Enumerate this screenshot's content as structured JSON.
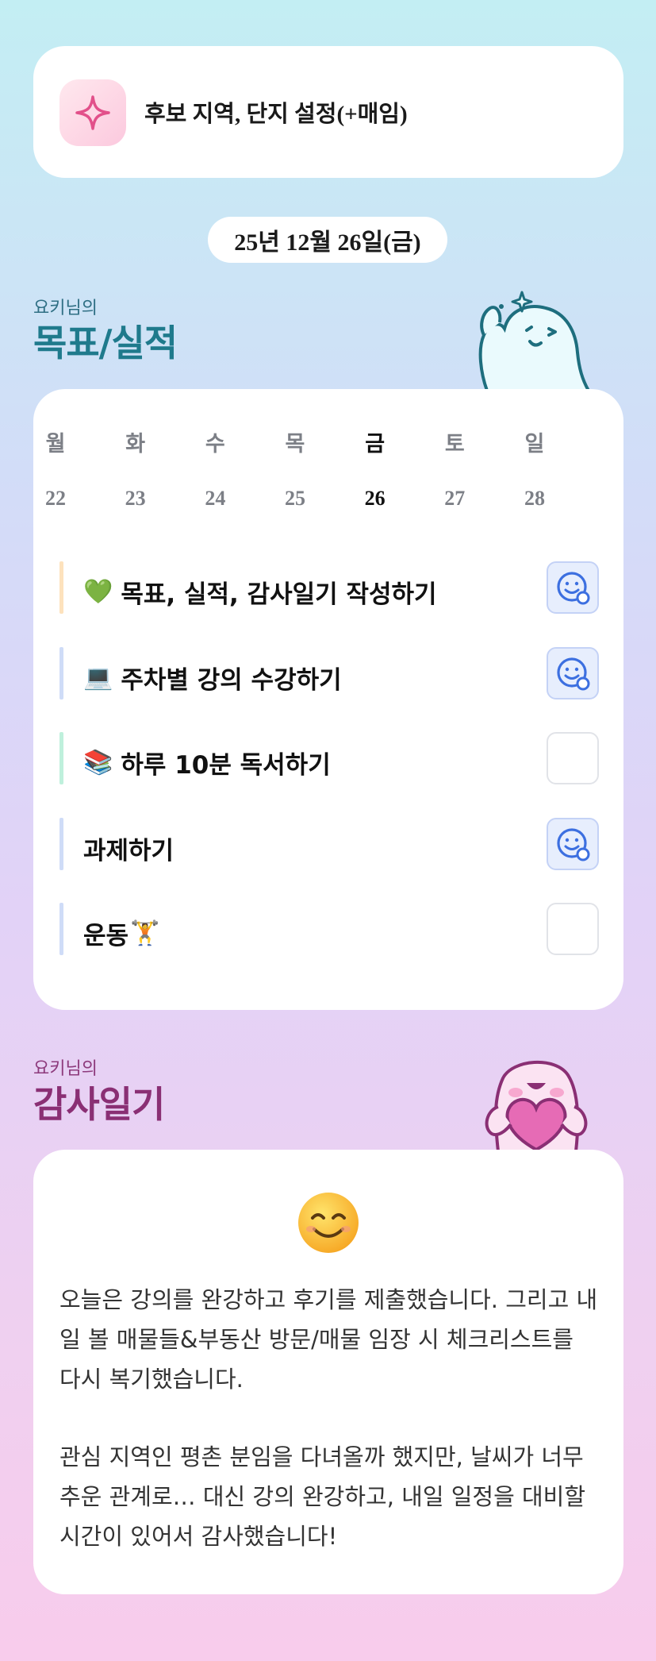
{
  "header": {
    "title": "후보 지역, 단지 설정(+매임)",
    "icon": "sparkle-icon"
  },
  "date": "25년 12월 26일(금)",
  "goals_section": {
    "owner_label": "요키님의",
    "title": "목표/실적"
  },
  "week": {
    "days": [
      "월",
      "화",
      "수",
      "목",
      "금",
      "토",
      "일"
    ],
    "dates": [
      "22",
      "23",
      "24",
      "25",
      "26",
      "27",
      "28"
    ],
    "today_index": 4
  },
  "tasks": [
    {
      "emoji": "💚",
      "label": "목표, 실적, 감사일기 작성하기",
      "done": true,
      "bar_color": "#fde2bd"
    },
    {
      "emoji": "💻",
      "label": "주차별 강의 수강하기",
      "done": true,
      "bar_color": "#cfdcf7"
    },
    {
      "emoji": "📚",
      "label": "하루 10분 독서하기",
      "done": false,
      "bar_color": "#bff0dc"
    },
    {
      "emoji": "",
      "label": "과제하기",
      "done": true,
      "bar_color": "#cfdcf7"
    },
    {
      "emoji": "🏋",
      "label": "운동",
      "done": false,
      "bar_color": "#cfdcf7"
    }
  ],
  "gratitude_section": {
    "owner_label": "요키님의",
    "title": "감사일기",
    "mood_icon": "smiling-face-icon",
    "paragraphs": [
      "오늘은 강의를 완강하고 후기를 제출했습니다. 그리고 내일 볼 매물들&부동산 방문/매물 임장 시 체크리스트를 다시 복기했습니다.",
      "관심 지역인 평촌 분임을 다녀올까 했지만, 날씨가 너무 추운 관계로… 대신 강의 완강하고, 내일 일정을 대비할 시간이 있어서 감사했습니다!"
    ]
  },
  "colors": {
    "goals_title": "#1f7a8c",
    "gratitude_title": "#8a2f74",
    "check_done_bg": "#e7eefd",
    "check_done_icon": "#3c6fe0"
  }
}
